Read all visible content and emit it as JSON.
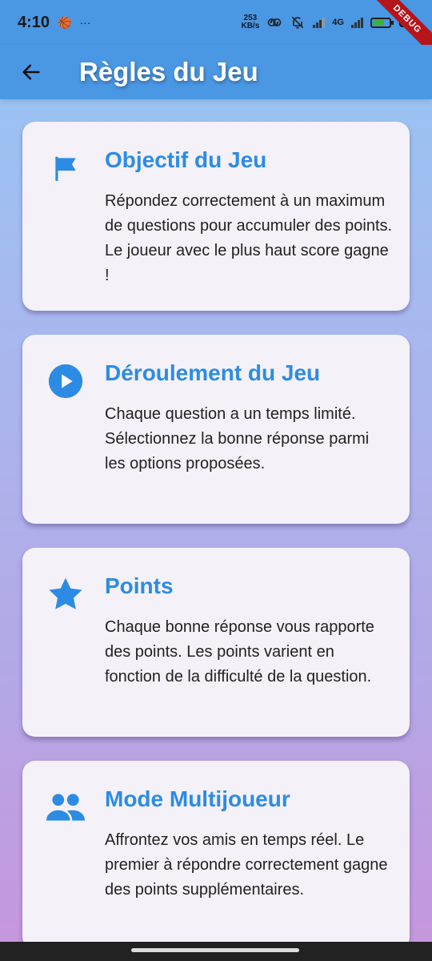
{
  "status_bar": {
    "time": "4:10",
    "dots": "···",
    "net_speed_top": "253",
    "net_speed_bottom": "KB/s",
    "network": "4G",
    "battery_pct": "64",
    "debug_label": "DEBUG"
  },
  "app_bar": {
    "title": "Règles du Jeu",
    "back_icon": "arrow-back-icon"
  },
  "cards": [
    {
      "icon": "flag-icon",
      "title": "Objectif du Jeu",
      "text": "Répondez correctement à un maximum de questions pour accumuler des points. Le joueur avec le plus haut score gagne !"
    },
    {
      "icon": "play-circle-icon",
      "title": "Déroulement du Jeu",
      "text": "Chaque question a un temps limité. Sélectionnez la bonne réponse parmi les options proposées."
    },
    {
      "icon": "star-icon",
      "title": "Points",
      "text": "Chaque bonne réponse vous rapporte des points. Les points varient en fonction de la difficulté de la question."
    },
    {
      "icon": "people-icon",
      "title": "Mode Multijoueur",
      "text": "Affrontez vos amis en temps réel. Le premier à répondre correctement gagne des points supplémentaires."
    }
  ],
  "colors": {
    "app_bar": "#4a97e4",
    "accent": "#2c8ce3",
    "card_bg": "#f4f1f8"
  }
}
